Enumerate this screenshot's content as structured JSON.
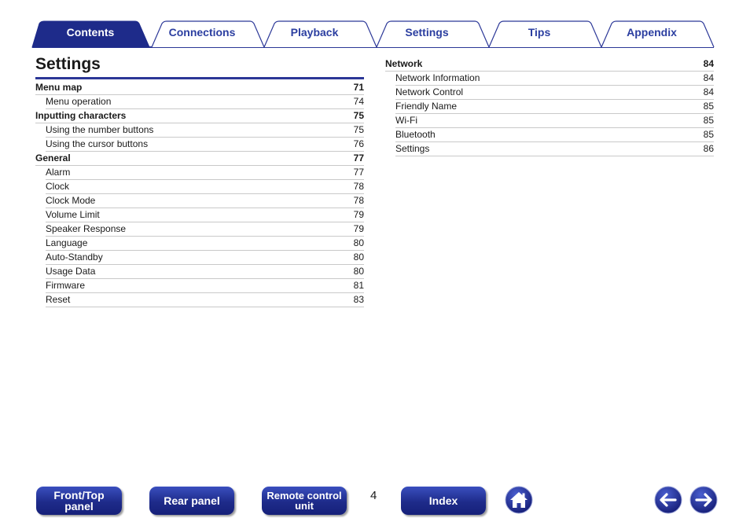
{
  "tabs": [
    {
      "label": "Contents",
      "active": true
    },
    {
      "label": "Connections",
      "active": false
    },
    {
      "label": "Playback",
      "active": false
    },
    {
      "label": "Settings",
      "active": false
    },
    {
      "label": "Tips",
      "active": false
    },
    {
      "label": "Appendix",
      "active": false
    }
  ],
  "title": "Settings",
  "left_toc": [
    {
      "label": "Menu map",
      "page": "71",
      "level": "head"
    },
    {
      "label": "Menu operation",
      "page": "74",
      "level": "sub"
    },
    {
      "label": "Inputting characters",
      "page": "75",
      "level": "head"
    },
    {
      "label": "Using the number buttons",
      "page": "75",
      "level": "sub"
    },
    {
      "label": "Using the cursor buttons",
      "page": "76",
      "level": "sub"
    },
    {
      "label": "General",
      "page": "77",
      "level": "head"
    },
    {
      "label": "Alarm",
      "page": "77",
      "level": "sub"
    },
    {
      "label": "Clock",
      "page": "78",
      "level": "sub"
    },
    {
      "label": "Clock Mode",
      "page": "78",
      "level": "sub"
    },
    {
      "label": "Volume Limit",
      "page": "79",
      "level": "sub"
    },
    {
      "label": "Speaker Response",
      "page": "79",
      "level": "sub"
    },
    {
      "label": "Language",
      "page": "80",
      "level": "sub"
    },
    {
      "label": "Auto-Standby",
      "page": "80",
      "level": "sub"
    },
    {
      "label": "Usage Data",
      "page": "80",
      "level": "sub"
    },
    {
      "label": "Firmware",
      "page": "81",
      "level": "sub"
    },
    {
      "label": "Reset",
      "page": "83",
      "level": "sub"
    }
  ],
  "right_toc": [
    {
      "label": "Network",
      "page": "84",
      "level": "head"
    },
    {
      "label": "Network Information",
      "page": "84",
      "level": "sub"
    },
    {
      "label": "Network Control",
      "page": "84",
      "level": "sub"
    },
    {
      "label": "Friendly Name",
      "page": "85",
      "level": "sub"
    },
    {
      "label": "Wi-Fi",
      "page": "85",
      "level": "sub"
    },
    {
      "label": "Bluetooth",
      "page": "85",
      "level": "sub"
    },
    {
      "label": "Settings",
      "page": "86",
      "level": "sub"
    }
  ],
  "bottom_nav": {
    "front_top_panel": "Front/Top panel",
    "rear_panel": "Rear panel",
    "remote_control_unit": "Remote control unit",
    "index": "Index",
    "home_icon": "home-icon",
    "back_icon": "arrow-left-icon",
    "forward_icon": "arrow-right-icon"
  },
  "page_number": "4",
  "colors": {
    "accent": "#2b3797",
    "tab_text": "#2b3ea0",
    "tab_active": "#1e2b8a"
  }
}
